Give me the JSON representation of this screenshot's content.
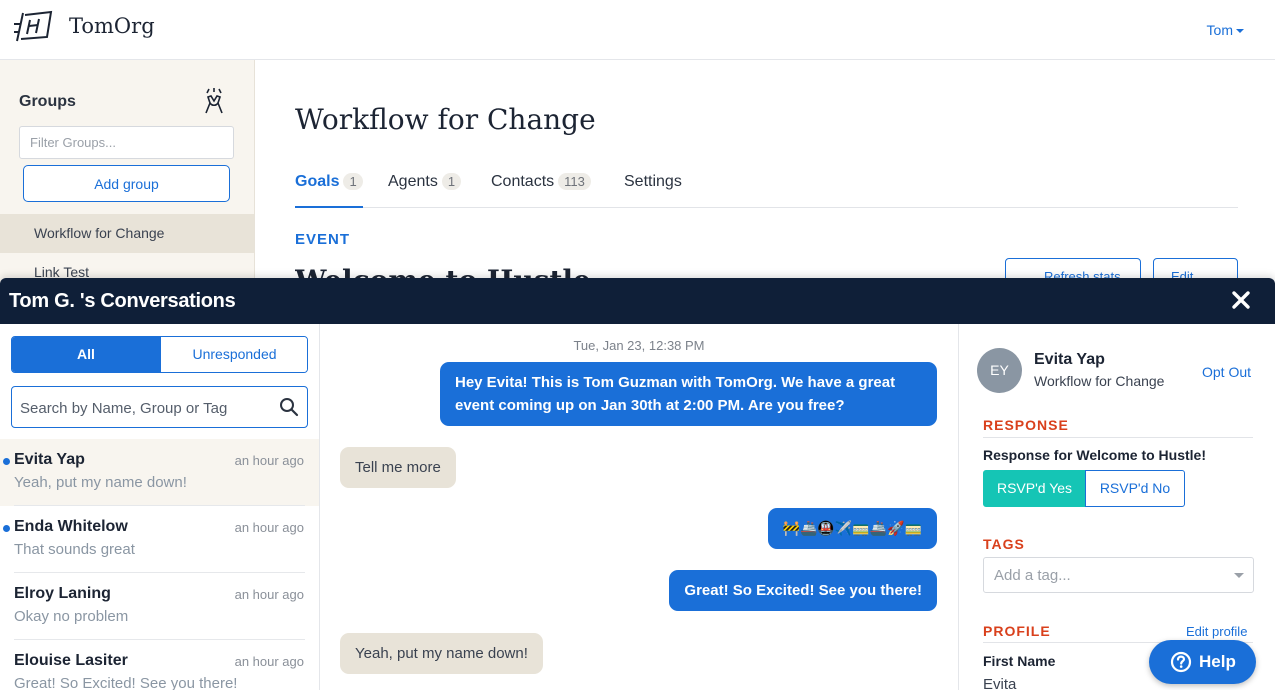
{
  "header": {
    "org_name": "TomOrg",
    "user_menu": "Tom"
  },
  "sidebar": {
    "title": "Groups",
    "filter_placeholder": "Filter Groups...",
    "add_group_label": "Add group",
    "items": [
      {
        "label": "Workflow for Change",
        "active": true
      },
      {
        "label": "Link Test",
        "active": false
      }
    ]
  },
  "main": {
    "title": "Workflow for Change",
    "tabs": [
      {
        "label": "Goals",
        "count": "1",
        "active": true
      },
      {
        "label": "Agents",
        "count": "1",
        "active": false
      },
      {
        "label": "Contacts",
        "count": "113",
        "active": false
      },
      {
        "label": "Settings",
        "count": "",
        "active": false
      }
    ],
    "event_label": "EVENT",
    "event_title": "Welcome to Hustle",
    "refresh_label": "Refresh stats",
    "edit_label": "Edit"
  },
  "conversations": {
    "title": "Tom G. 's Conversations",
    "filter_all": "All",
    "filter_unresponded": "Unresponded",
    "search_placeholder": "Search by Name, Group or Tag",
    "items": [
      {
        "name": "Evita Yap",
        "time": "an hour ago",
        "snippet": "Yeah, put my name down!",
        "unread": true,
        "selected": true
      },
      {
        "name": "Enda Whitelow",
        "time": "an hour ago",
        "snippet": "That sounds great",
        "unread": true,
        "selected": false
      },
      {
        "name": "Elroy Laning",
        "time": "an hour ago",
        "snippet": "Okay no problem",
        "unread": false,
        "selected": false
      },
      {
        "name": "Elouise Lasiter",
        "time": "an hour ago",
        "snippet": "Great! So Excited! See you there!",
        "unread": false,
        "selected": false
      }
    ]
  },
  "thread": {
    "date": "Tue, Jan 23, 12:38 PM",
    "messages": [
      {
        "direction": "out",
        "text": "Hey Evita! This is Tom Guzman with TomOrg. We have a great event coming up on Jan 30th at 2:00 PM. Are you free?"
      },
      {
        "direction": "in",
        "text": "Tell me more"
      },
      {
        "direction": "out",
        "text": "🚧🚢🚇✈️🚃🚢🚀🚃"
      },
      {
        "direction": "out",
        "text": "Great! So Excited! See you there!"
      },
      {
        "direction": "in",
        "text": "Yeah, put my name down!"
      }
    ]
  },
  "details": {
    "initials": "EY",
    "name": "Evita Yap",
    "group": "Workflow for Change",
    "opt_out_label": "Opt Out",
    "response_label": "RESPONSE",
    "response_question": "Response for Welcome to Hustle!",
    "rsvp_yes": "RSVP'd Yes",
    "rsvp_no": "RSVP'd No",
    "tags_label": "TAGS",
    "tag_placeholder": "Add a tag...",
    "profile_label": "PROFILE",
    "edit_profile_label": "Edit profile",
    "first_name_label": "First Name",
    "first_name_value": "Evita"
  },
  "help": {
    "label": "Help"
  },
  "colors": {
    "accent": "#1a6fd8",
    "header_dark": "#0f1f38",
    "section_red": "#d9401c",
    "rsvp_teal": "#15c5b5",
    "sidebar_bg": "#f8f5ef",
    "incoming_bubble": "#e8e3d8"
  }
}
